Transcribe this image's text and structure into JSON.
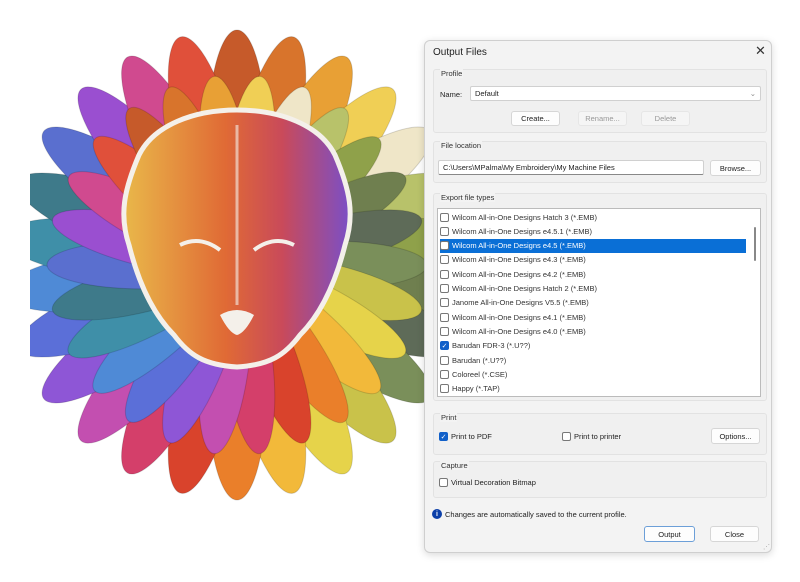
{
  "dialog": {
    "title": "Output Files",
    "close_icon": "close-icon"
  },
  "profile": {
    "group_label": "Profile",
    "name_label": "Name:",
    "name_value": "Default",
    "create": "Create...",
    "rename": "Rename...",
    "delete": "Delete"
  },
  "file_location": {
    "group_label": "File location",
    "path": "C:\\Users\\MPalma\\My Embroidery\\My Machine Files",
    "browse": "Browse..."
  },
  "export": {
    "group_label": "Export file types",
    "items": [
      {
        "label": "Wilcom All-in-One Designs Hatch 3 (*.EMB)",
        "checked": false,
        "selected": false
      },
      {
        "label": "Wilcom All-in-One Designs e4.5.1 (*.EMB)",
        "checked": false,
        "selected": false
      },
      {
        "label": "Wilcom All-in-One Designs e4.5 (*.EMB)",
        "checked": false,
        "selected": true
      },
      {
        "label": "Wilcom All-in-One Designs e4.3 (*.EMB)",
        "checked": false,
        "selected": false
      },
      {
        "label": "Wilcom All-in-One Designs e4.2 (*.EMB)",
        "checked": false,
        "selected": false
      },
      {
        "label": "Wilcom All-in-One Designs Hatch 2 (*.EMB)",
        "checked": false,
        "selected": false
      },
      {
        "label": "Janome All-in-One Designs V5.5 (*.EMB)",
        "checked": false,
        "selected": false
      },
      {
        "label": "Wilcom All-in-One Designs e4.1 (*.EMB)",
        "checked": false,
        "selected": false
      },
      {
        "label": "Wilcom All-in-One Designs e4.0 (*.EMB)",
        "checked": false,
        "selected": false
      },
      {
        "label": "Barudan FDR-3 (*.U??)",
        "checked": true,
        "selected": false
      },
      {
        "label": "Barudan (*.U??)",
        "checked": false,
        "selected": false
      },
      {
        "label": "Coloreel (*.CSE)",
        "checked": false,
        "selected": false
      },
      {
        "label": "Happy (*.TAP)",
        "checked": false,
        "selected": false
      }
    ]
  },
  "print": {
    "group_label": "Print",
    "print_to_pdf": "Print to PDF",
    "print_to_pdf_checked": true,
    "print_to_printer": "Print to printer",
    "print_to_printer_checked": false,
    "options": "Options..."
  },
  "capture": {
    "group_label": "Capture",
    "virtual_decoration": "Virtual Decoration Bitmap",
    "virtual_decoration_checked": false
  },
  "info": "Changes are automatically saved to the current profile.",
  "footer": {
    "output": "Output",
    "close": "Close"
  }
}
